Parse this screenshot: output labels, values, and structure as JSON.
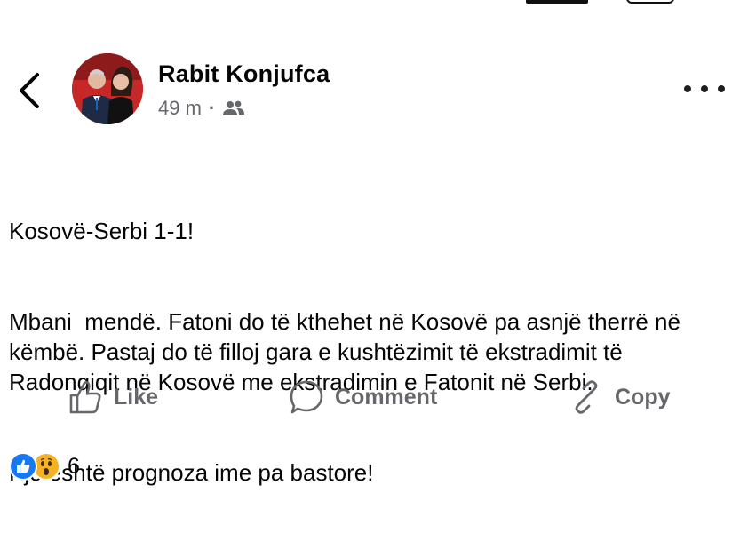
{
  "post": {
    "author": "Rabit Konjufca",
    "time": "49 m",
    "dot": "·",
    "audience_icon": "friends-icon",
    "lines": [
      "Kosovë-Serbi 1-1!",
      "Mbani  mendë. Fatoni do të kthehet në Kosovë pa asnjë therrë në këmbë. Pastaj do të filloj gara e kushtëzimit të ekstradimit të Radonqiqit në Kosovë me ekstradimin e Fatonit në Serbi.",
      "Kjo është prognoza ime pa bastore!"
    ]
  },
  "actions": {
    "like_label": "Like",
    "comment_label": "Comment",
    "copy_label": "Copy"
  },
  "reactions": {
    "icons": [
      "like-reaction-icon",
      "wow-reaction-icon"
    ],
    "count": "6"
  },
  "colors": {
    "text": "#050505",
    "secondary": "#65676b",
    "like_blue": "#1877f2",
    "wow_yellow": "#f7b125"
  }
}
